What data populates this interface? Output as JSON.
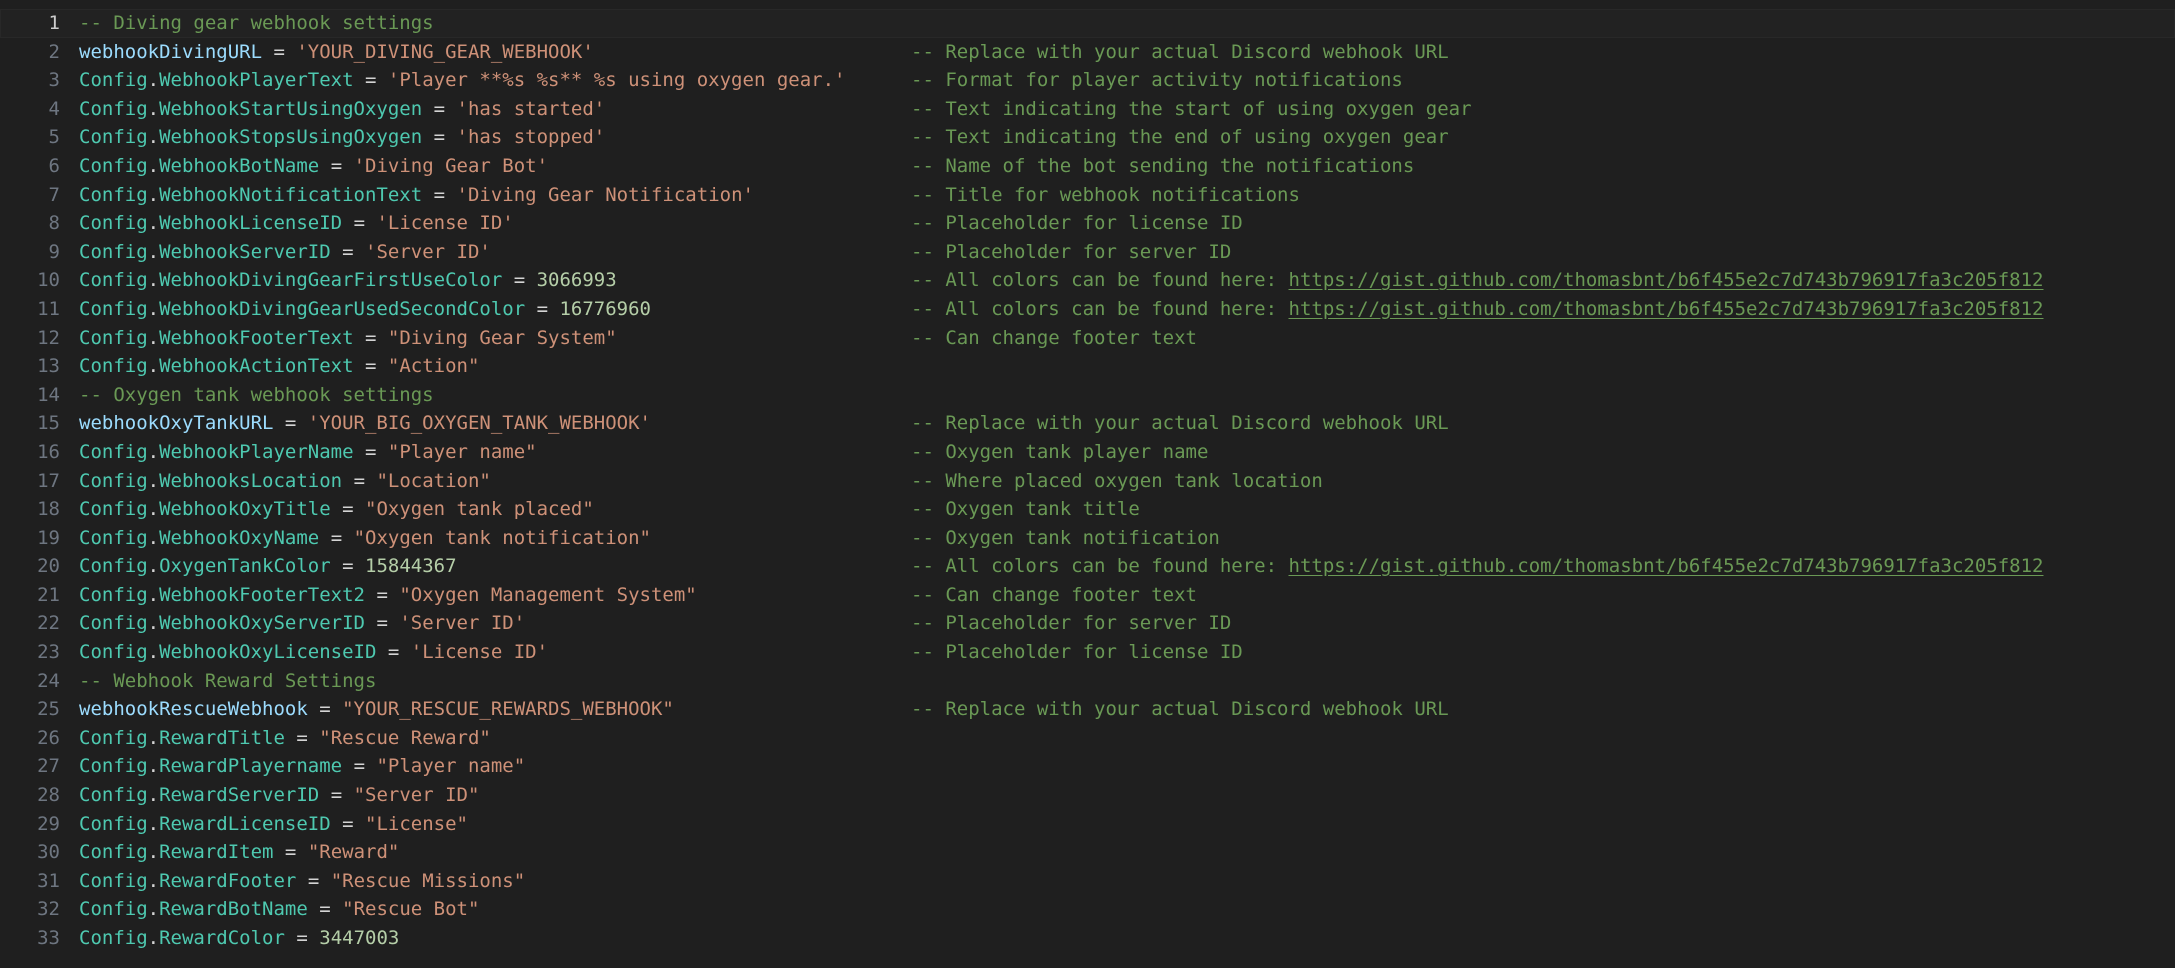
{
  "lines": [
    {
      "n": "1",
      "active": true,
      "type": "comment",
      "text": "-- Diving gear webhook settings"
    },
    {
      "n": "2",
      "type": "var",
      "name": "webhookDivingURL",
      "value": "'YOUR_DIVING_GEAR_WEBHOOK'",
      "vtype": "str",
      "comment": "-- Replace with your actual Discord webhook URL"
    },
    {
      "n": "3",
      "type": "cfg",
      "prop": "WebhookPlayerText",
      "value": "'Player **%s %s** %s using oxygen gear.'",
      "vtype": "str",
      "comment": "-- Format for player activity notifications"
    },
    {
      "n": "4",
      "type": "cfg",
      "prop": "WebhookStartUsingOxygen",
      "value": "'has started'",
      "vtype": "str",
      "comment": "-- Text indicating the start of using oxygen gear"
    },
    {
      "n": "5",
      "type": "cfg",
      "prop": "WebhookStopsUsingOxygen",
      "value": "'has stopped'",
      "vtype": "str",
      "comment": "-- Text indicating the end of using oxygen gear"
    },
    {
      "n": "6",
      "type": "cfg",
      "prop": "WebhookBotName",
      "value": "'Diving Gear Bot'",
      "vtype": "str",
      "comment": "-- Name of the bot sending the notifications"
    },
    {
      "n": "7",
      "type": "cfg",
      "prop": "WebhookNotificationText",
      "value": "'Diving Gear Notification'",
      "vtype": "str",
      "comment": "-- Title for webhook notifications"
    },
    {
      "n": "8",
      "type": "cfg",
      "prop": "WebhookLicenseID",
      "value": "'License ID'",
      "vtype": "str",
      "comment": "-- Placeholder for license ID"
    },
    {
      "n": "9",
      "type": "cfg",
      "prop": "WebhookServerID",
      "value": "'Server ID'",
      "vtype": "str",
      "comment": "-- Placeholder for server ID"
    },
    {
      "n": "10",
      "type": "cfg",
      "prop": "WebhookDivingGearFirstUseColor",
      "value": "3066993",
      "vtype": "num",
      "comment": "-- All colors can be found here: ",
      "link": "https://gist.github.com/thomasbnt/b6f455e2c7d743b796917fa3c205f812"
    },
    {
      "n": "11",
      "type": "cfg",
      "prop": "WebhookDivingGearUsedSecondColor",
      "value": "16776960",
      "vtype": "num",
      "comment": "-- All colors can be found here: ",
      "link": "https://gist.github.com/thomasbnt/b6f455e2c7d743b796917fa3c205f812"
    },
    {
      "n": "12",
      "type": "cfg",
      "prop": "WebhookFooterText",
      "value": "\"Diving Gear System\"",
      "vtype": "str",
      "comment": "-- Can change footer text"
    },
    {
      "n": "13",
      "type": "cfg",
      "prop": "WebhookActionText",
      "value": "\"Action\"",
      "vtype": "str"
    },
    {
      "n": "14",
      "type": "comment",
      "text": "-- Oxygen tank webhook settings"
    },
    {
      "n": "15",
      "type": "var",
      "name": "webhookOxyTankURL",
      "value": "'YOUR_BIG_OXYGEN_TANK_WEBHOOK'",
      "vtype": "str",
      "comment": "-- Replace with your actual Discord webhook URL"
    },
    {
      "n": "16",
      "type": "cfg",
      "prop": "WebhookPlayerName",
      "value": "\"Player name\"",
      "vtype": "str",
      "comment": "-- Oxygen tank player name"
    },
    {
      "n": "17",
      "type": "cfg",
      "prop": "WebhooksLocation",
      "value": "\"Location\"",
      "vtype": "str",
      "comment": "-- Where placed oxygen tank location"
    },
    {
      "n": "18",
      "type": "cfg",
      "prop": "WebhookOxyTitle",
      "value": "\"Oxygen tank placed\"",
      "vtype": "str",
      "comment": "-- Oxygen tank title"
    },
    {
      "n": "19",
      "type": "cfg",
      "prop": "WebhookOxyName",
      "value": "\"Oxygen tank notification\"",
      "vtype": "str",
      "comment": "-- Oxygen tank notification"
    },
    {
      "n": "20",
      "type": "cfg",
      "prop": "OxygenTankColor",
      "value": "15844367",
      "vtype": "num",
      "comment": "-- All colors can be found here: ",
      "link": "https://gist.github.com/thomasbnt/b6f455e2c7d743b796917fa3c205f812"
    },
    {
      "n": "21",
      "type": "cfg",
      "prop": "WebhookFooterText2",
      "value": "\"Oxygen Management System\"",
      "vtype": "str",
      "comment": "-- Can change footer text"
    },
    {
      "n": "22",
      "type": "cfg",
      "prop": "WebhookOxyServerID",
      "value": "'Server ID'",
      "vtype": "str",
      "comment": "-- Placeholder for server ID"
    },
    {
      "n": "23",
      "type": "cfg",
      "prop": "WebhookOxyLicenseID",
      "value": "'License ID'",
      "vtype": "str",
      "comment": "-- Placeholder for license ID"
    },
    {
      "n": "24",
      "type": "comment",
      "text": "-- Webhook Reward Settings"
    },
    {
      "n": "25",
      "type": "var",
      "name": "webhookRescueWebhook",
      "value": "\"YOUR_RESCUE_REWARDS_WEBHOOK\"",
      "vtype": "str",
      "comment": "-- Replace with your actual Discord webhook URL"
    },
    {
      "n": "26",
      "type": "cfg",
      "prop": "RewardTitle",
      "value": "\"Rescue Reward\"",
      "vtype": "str"
    },
    {
      "n": "27",
      "type": "cfg",
      "prop": "RewardPlayername",
      "value": "\"Player name\"",
      "vtype": "str"
    },
    {
      "n": "28",
      "type": "cfg",
      "prop": "RewardServerID",
      "value": "\"Server ID\"",
      "vtype": "str"
    },
    {
      "n": "29",
      "type": "cfg",
      "prop": "RewardLicenseID",
      "value": "\"License\"",
      "vtype": "str"
    },
    {
      "n": "30",
      "type": "cfg",
      "prop": "RewardItem",
      "value": "\"Reward\"",
      "vtype": "str"
    },
    {
      "n": "31",
      "type": "cfg",
      "prop": "RewardFooter",
      "value": "\"Rescue Missions\"",
      "vtype": "str"
    },
    {
      "n": "32",
      "type": "cfg",
      "prop": "RewardBotName",
      "value": "\"Rescue Bot\"",
      "vtype": "str"
    },
    {
      "n": "33",
      "type": "cfg",
      "prop": "RewardColor",
      "value": "3447003",
      "vtype": "num"
    }
  ]
}
